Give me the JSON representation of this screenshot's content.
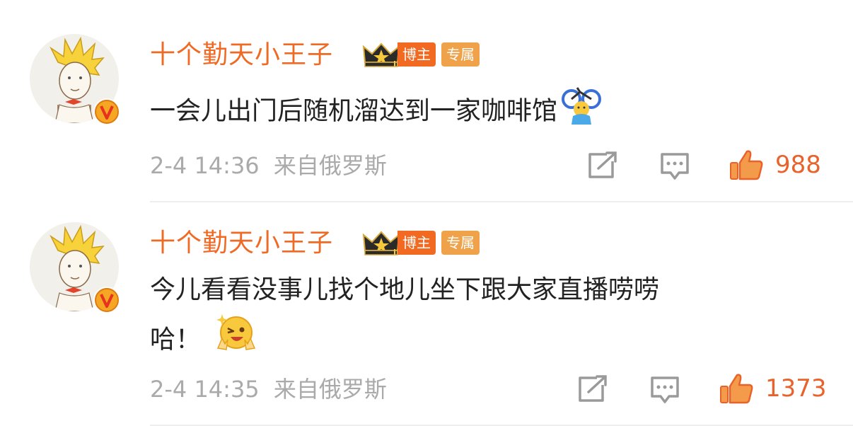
{
  "colors": {
    "username": "#ef6a24",
    "badge_host": "#f26a21",
    "badge_exclusive": "#f0a24a",
    "meta_text": "#aaaaaa",
    "like": "#e8632b",
    "body_text": "#222222"
  },
  "comments": [
    {
      "username": "十个勤天小王子",
      "badges": {
        "host": "博主",
        "exclusive": "专属"
      },
      "lines": [
        "一会儿出门后随机溜达到一家咖啡馆"
      ],
      "emoji": "cycling-person-emoji",
      "time": "2-4 14:36",
      "source": "来自俄罗斯",
      "likes": "988",
      "icons": [
        "share-icon",
        "comment-icon",
        "thumbs-up-icon"
      ]
    },
    {
      "username": "十个勤天小王子",
      "badges": {
        "host": "博主",
        "exclusive": "专属"
      },
      "lines": [
        "今儿看看没事儿找个地儿坐下跟大家直播唠唠",
        "哈！"
      ],
      "emoji": "winking-victory-emoji",
      "time": "2-4 14:35",
      "source": "来自俄罗斯",
      "likes": "1373",
      "icons": [
        "share-icon",
        "comment-icon",
        "thumbs-up-icon"
      ]
    }
  ]
}
